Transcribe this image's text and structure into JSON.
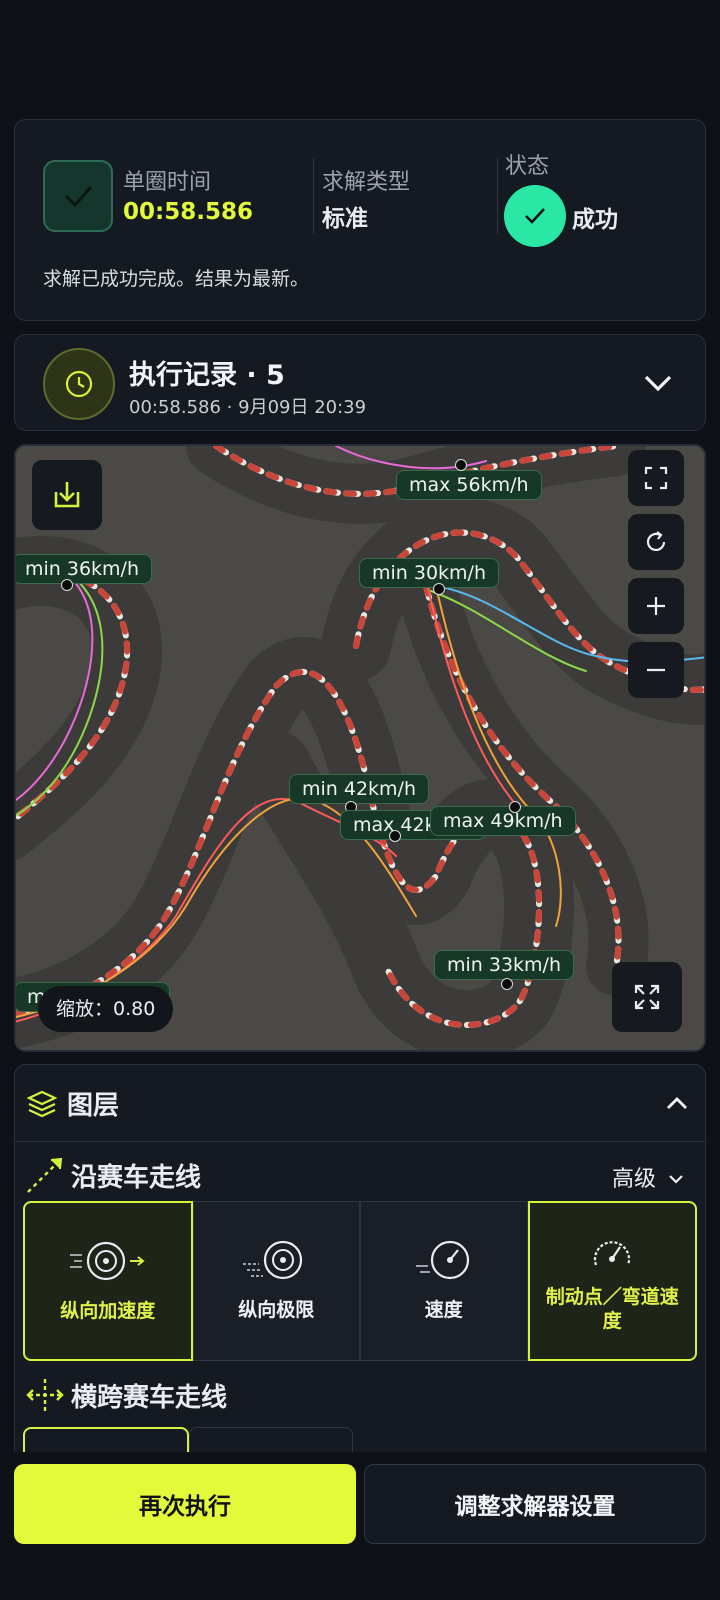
{
  "summary": {
    "lap_time_label": "单圈时间",
    "lap_time_value": "00:58.586",
    "solve_type_label": "求解类型",
    "solve_type_value": "标准",
    "status_label": "状态",
    "status_value": "成功",
    "message": "求解已成功完成。结果为最新。"
  },
  "history": {
    "title": "执行记录 · 5",
    "subtitle": "00:58.586 · 9月09日 20:39"
  },
  "map": {
    "speed_tags": [
      "max 56km/h",
      "min 36km/h",
      "min 30km/h",
      "min 42km/h",
      "max 42km/h",
      "max 49km/h",
      "min 33km/h",
      "max 5km/h"
    ],
    "zoom_text": "缩放：0.80"
  },
  "layers": {
    "title": "图层",
    "section1_title": "沿赛车走线",
    "advanced_label": "高级",
    "tiles": [
      {
        "label": "纵向加速度"
      },
      {
        "label": "纵向极限"
      },
      {
        "label": "速度"
      },
      {
        "label": "制动点／弯道速度"
      }
    ],
    "section2_title": "横跨赛车走线"
  },
  "actions": {
    "rerun_label": "再次执行",
    "adjust_label": "调整求解器设置"
  },
  "colors": {
    "accent": "#e3fa3a",
    "success": "#2be7a5",
    "background": "#0e1218"
  }
}
